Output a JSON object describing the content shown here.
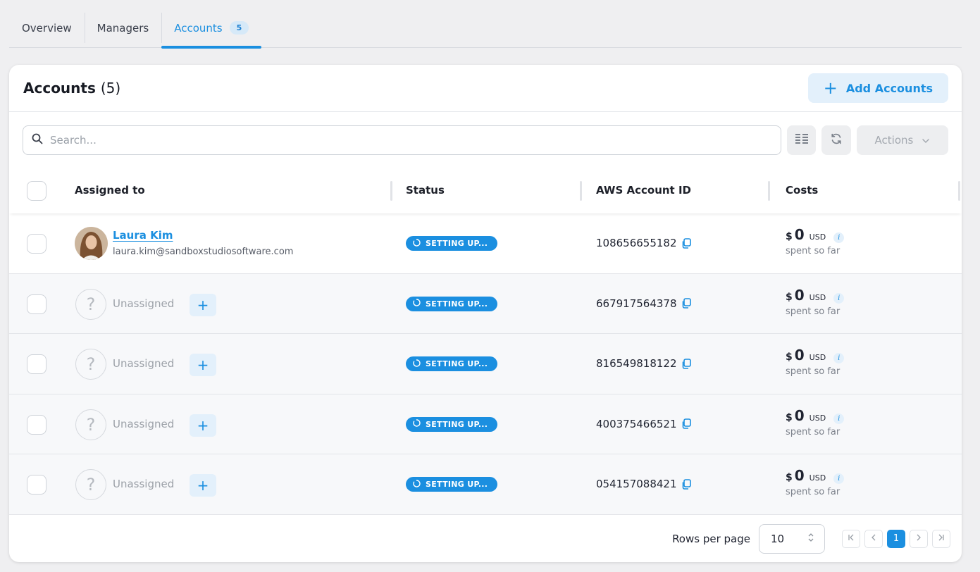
{
  "tabs": [
    {
      "label": "Overview"
    },
    {
      "label": "Managers"
    },
    {
      "label": "Accounts",
      "badge": "5",
      "active": true
    }
  ],
  "card": {
    "title": "Accounts",
    "count": "(5)",
    "add_button": "Add Accounts"
  },
  "toolbar": {
    "search_placeholder": "Search...",
    "actions_label": "Actions"
  },
  "table": {
    "headers": {
      "assigned": "Assigned to",
      "status": "Status",
      "aws_id": "AWS Account ID",
      "costs": "Costs"
    },
    "rows": [
      {
        "name": "Laura Kim",
        "email": "laura.kim@sandboxstudiosoftware.com",
        "status": "SETTING UP...",
        "aws_id": "108656655182",
        "cost_currency": "$",
        "cost_value": "0",
        "cost_unit": "USD",
        "cost_note": "spent so far"
      },
      {
        "assigned": "Unassigned",
        "status": "SETTING UP...",
        "aws_id": "667917564378",
        "cost_currency": "$",
        "cost_value": "0",
        "cost_unit": "USD",
        "cost_note": "spent so far"
      },
      {
        "assigned": "Unassigned",
        "status": "SETTING UP...",
        "aws_id": "816549818122",
        "cost_currency": "$",
        "cost_value": "0",
        "cost_unit": "USD",
        "cost_note": "spent so far"
      },
      {
        "assigned": "Unassigned",
        "status": "SETTING UP...",
        "aws_id": "400375466521",
        "cost_currency": "$",
        "cost_value": "0",
        "cost_unit": "USD",
        "cost_note": "spent so far"
      },
      {
        "assigned": "Unassigned",
        "status": "SETTING UP...",
        "aws_id": "054157088421",
        "cost_currency": "$",
        "cost_value": "0",
        "cost_unit": "USD",
        "cost_note": "spent so far"
      }
    ]
  },
  "footer": {
    "rows_per_page_label": "Rows per page",
    "rows_per_page_value": "10",
    "current_page": "1"
  },
  "colors": {
    "accent": "#1b8fe0",
    "accent_light": "#e3f0fb"
  }
}
